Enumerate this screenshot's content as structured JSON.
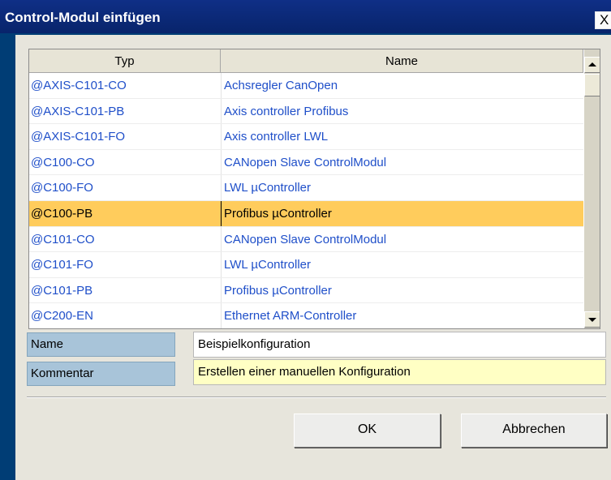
{
  "window": {
    "title": "Control-Modul einfügen",
    "close_label": "X"
  },
  "table": {
    "columns": [
      "Typ",
      "Name"
    ],
    "rows": [
      {
        "typ": "@AXIS-C101-CO",
        "name": "Achsregler CanOpen"
      },
      {
        "typ": "@AXIS-C101-PB",
        "name": "Axis controller Profibus"
      },
      {
        "typ": "@AXIS-C101-FO",
        "name": "Axis controller LWL"
      },
      {
        "typ": "@C100-CO",
        "name": "CANopen Slave ControlModul"
      },
      {
        "typ": "@C100-FO",
        "name": "LWL µController"
      },
      {
        "typ": "@C100-PB",
        "name": "Profibus µController"
      },
      {
        "typ": "@C101-CO",
        "name": "CANopen Slave ControlModul"
      },
      {
        "typ": "@C101-FO",
        "name": "LWL µController"
      },
      {
        "typ": "@C101-PB",
        "name": "Profibus µController"
      },
      {
        "typ": "@C200-EN",
        "name": "Ethernet ARM-Controller"
      }
    ],
    "selected_index": 5
  },
  "form": {
    "name_label": "Name",
    "name_value": "Beispielkonfiguration",
    "comment_label": "Kommentar",
    "comment_value": "Erstellen einer manuellen Konfiguration"
  },
  "buttons": {
    "ok": "OK",
    "cancel": "Abbrechen"
  },
  "colors": {
    "title_bar": "#0f2f86",
    "selected_row": "#ffcc5c",
    "link_text": "#1f4fc9",
    "comment_bg": "#ffffc4"
  }
}
